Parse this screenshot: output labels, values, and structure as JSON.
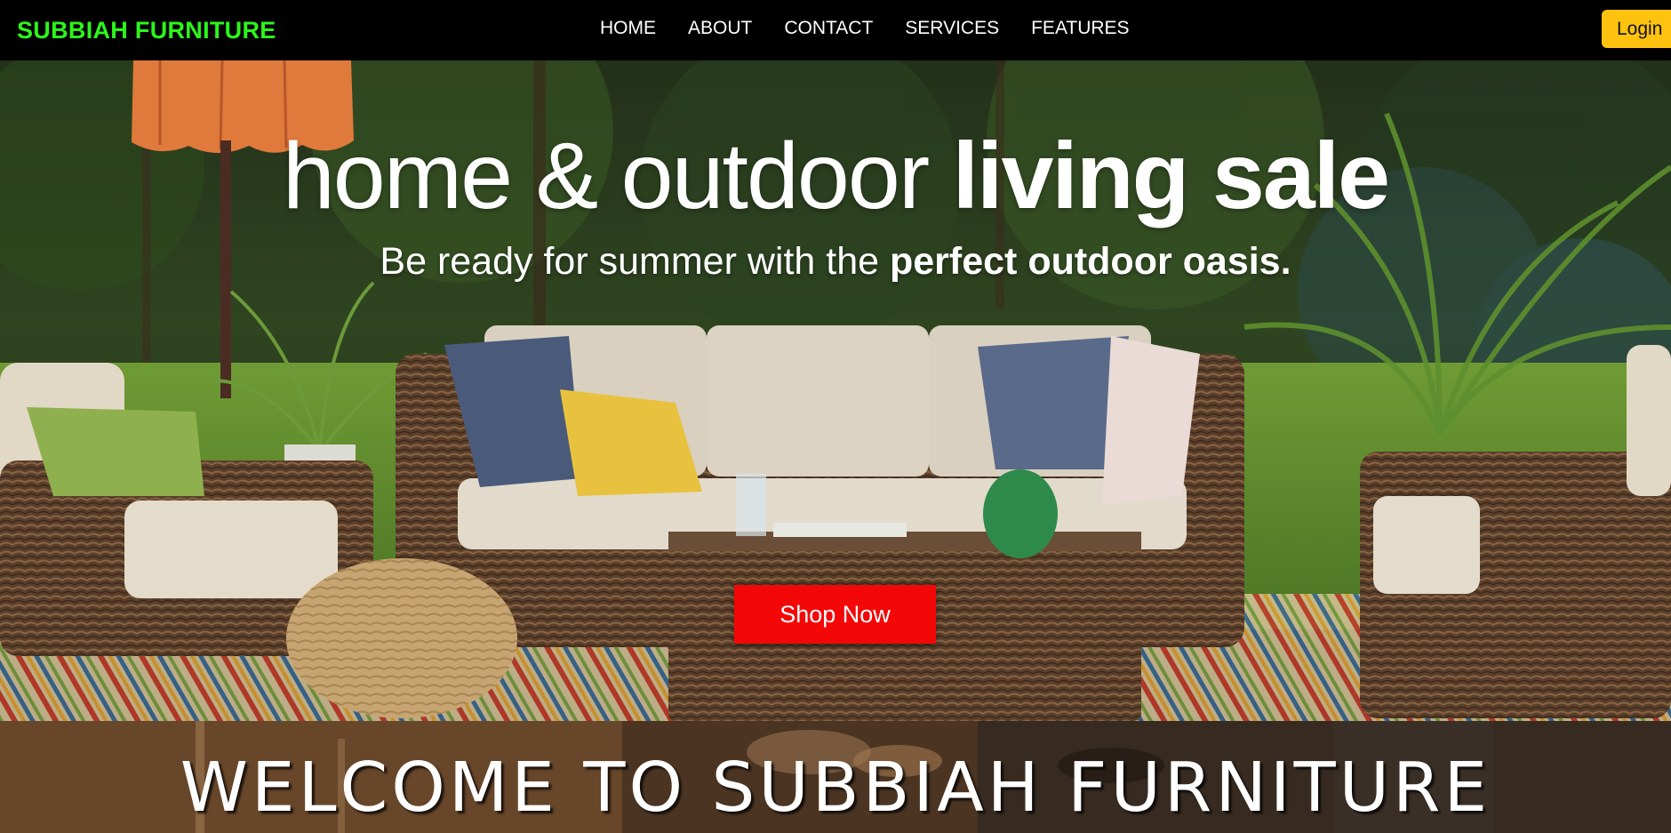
{
  "navbar": {
    "brand": "SUBBIAH FURNITURE",
    "links": [
      "HOME",
      "ABOUT",
      "CONTACT",
      "SERVICES",
      "FEATURES"
    ],
    "login_label": "Login",
    "brand_color": "#2df51b",
    "login_color": "#ffc30f"
  },
  "hero": {
    "title_regular": "home & outdoor ",
    "title_bold": "living sale",
    "subtitle_regular": "Be ready for summer with the ",
    "subtitle_bold": "perfect outdoor oasis.",
    "cta_label": "Shop Now",
    "cta_color": "#f40707",
    "background_image": "patio-wicker-sofa-scene"
  },
  "welcome": {
    "text": "WELCOME TO SUBBIAH FURNITURE"
  }
}
